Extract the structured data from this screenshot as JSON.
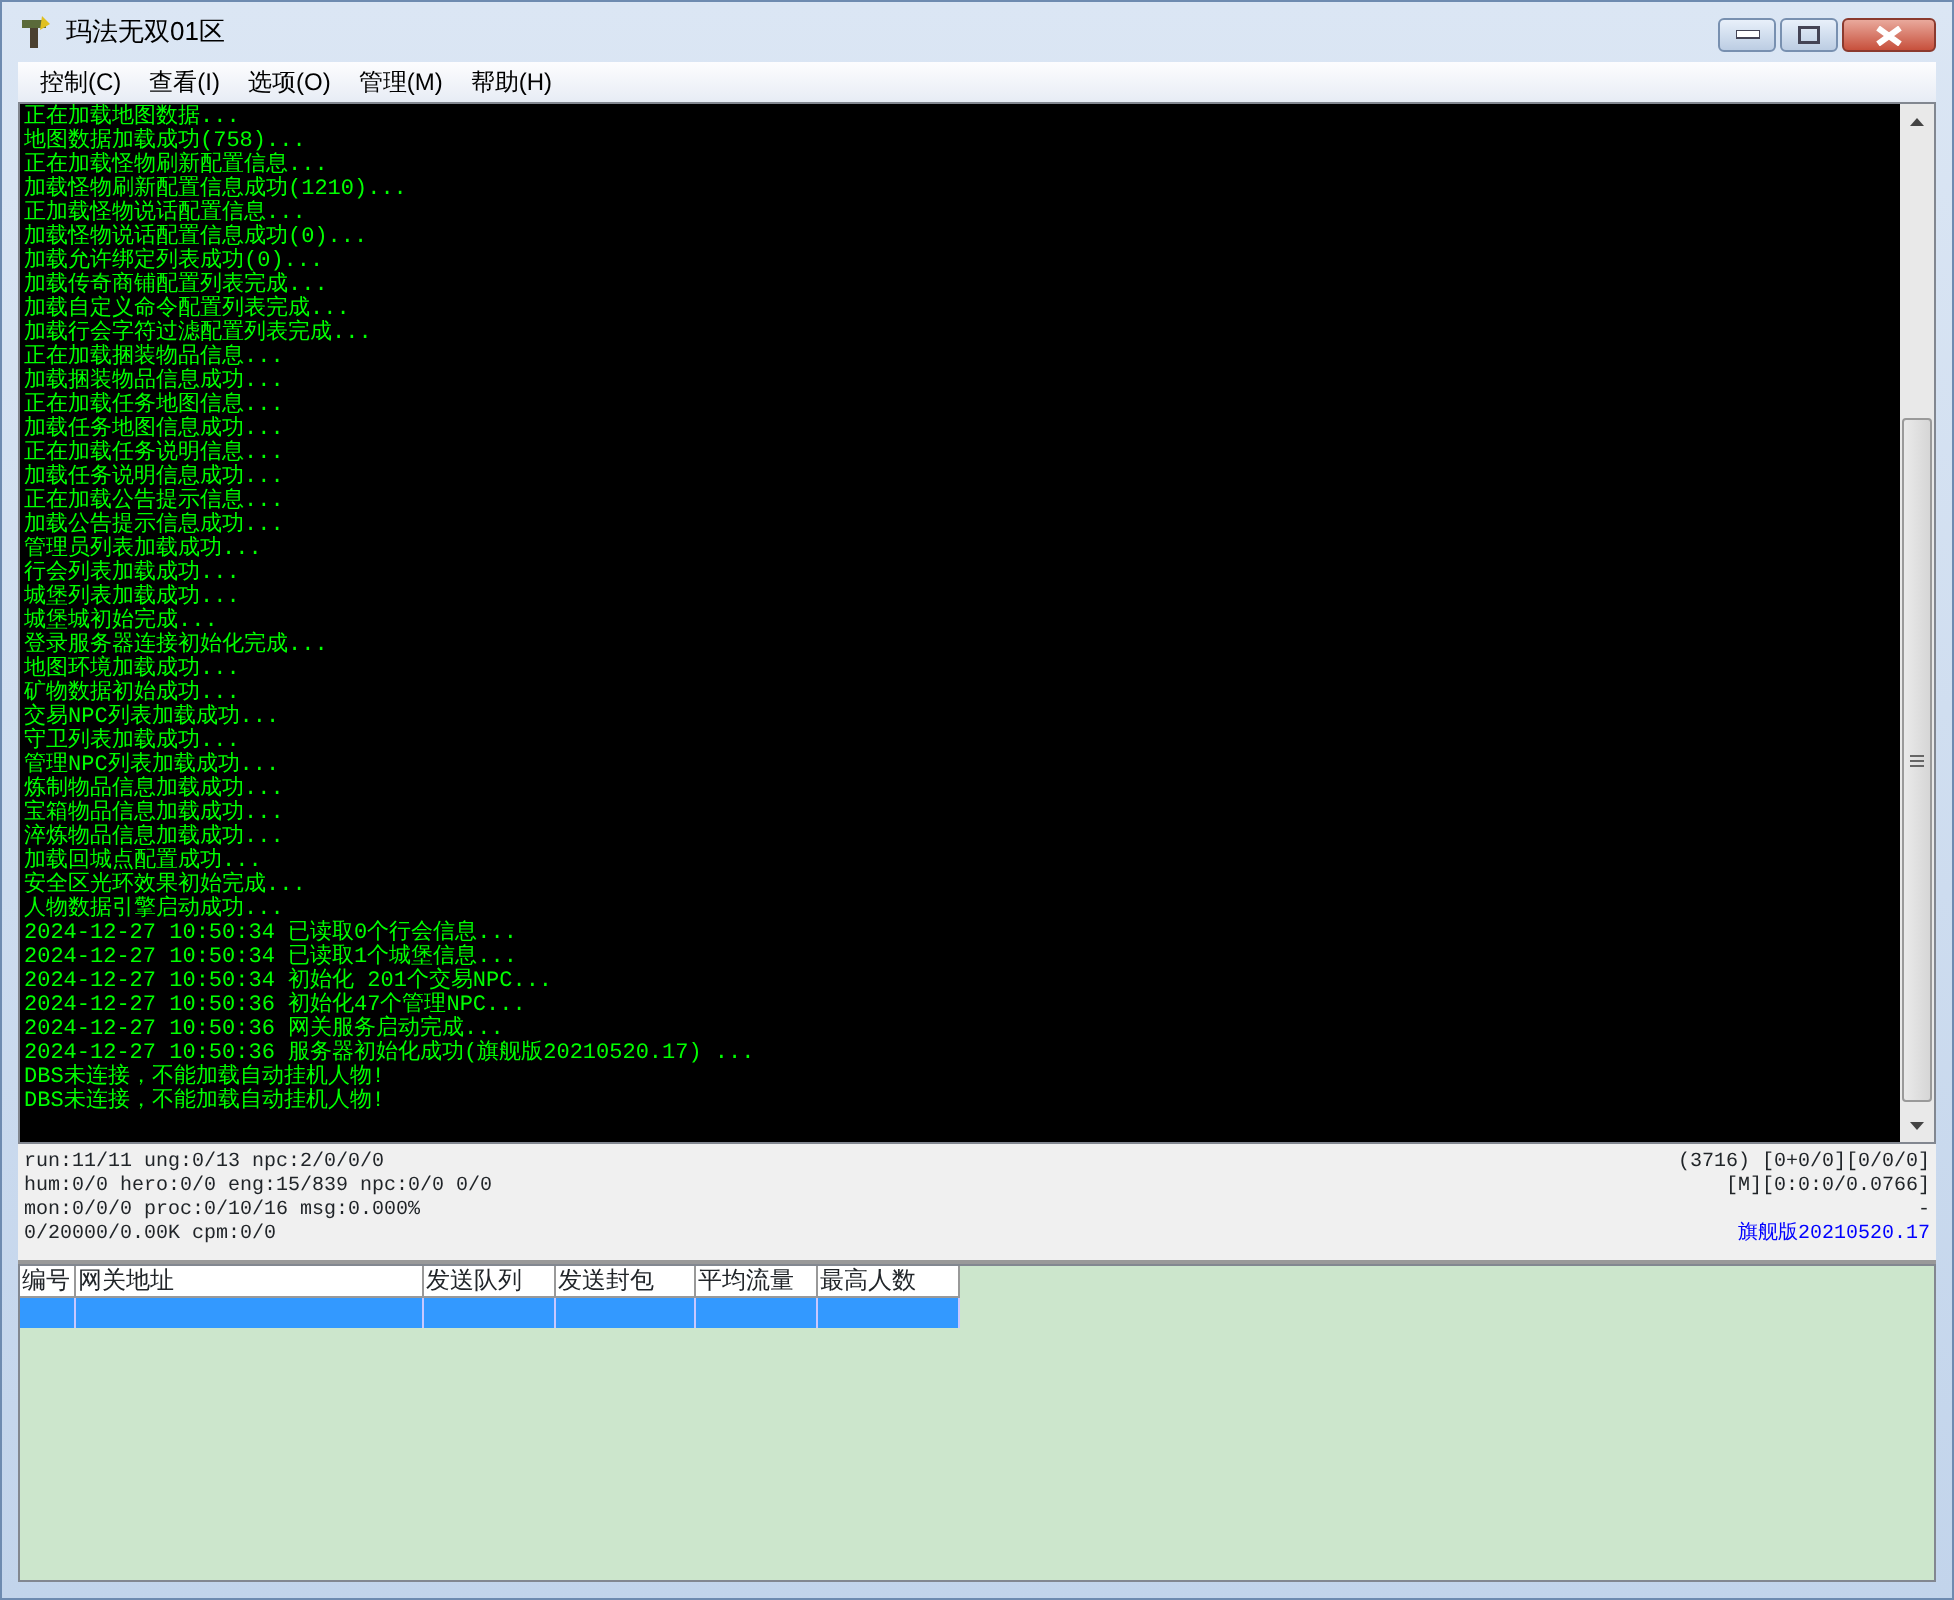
{
  "window": {
    "title": "玛法无双01区"
  },
  "menu": [
    "控制(C)",
    "查看(I)",
    "选项(O)",
    "管理(M)",
    "帮助(H)"
  ],
  "console": {
    "lines": [
      "正在加载地图数据...",
      "地图数据加载成功(758)...",
      "正在加载怪物刷新配置信息...",
      "加载怪物刷新配置信息成功(1210)...",
      "正加载怪物说话配置信息...",
      "加载怪物说话配置信息成功(0)...",
      "加载允许绑定列表成功(0)...",
      "加载传奇商铺配置列表完成...",
      "加载自定义命令配置列表完成...",
      "加载行会字符过滤配置列表完成...",
      "正在加载捆装物品信息...",
      "加载捆装物品信息成功...",
      "正在加载任务地图信息...",
      "加载任务地图信息成功...",
      "正在加载任务说明信息...",
      "加载任务说明信息成功...",
      "正在加载公告提示信息...",
      "加载公告提示信息成功...",
      "管理员列表加载成功...",
      "行会列表加载成功...",
      "城堡列表加载成功...",
      "城堡城初始完成...",
      "登录服务器连接初始化完成...",
      "地图环境加载成功...",
      "矿物数据初始成功...",
      "交易NPC列表加载成功...",
      "守卫列表加载成功...",
      "管理NPC列表加载成功...",
      "炼制物品信息加载成功...",
      "宝箱物品信息加载成功...",
      "淬炼物品信息加载成功...",
      "加载回城点配置成功...",
      "安全区光环效果初始完成...",
      "人物数据引擎启动成功...",
      "2024-12-27 10:50:34 已读取0个行会信息...",
      "2024-12-27 10:50:34 已读取1个城堡信息...",
      "2024-12-27 10:50:34 初始化 201个交易NPC...",
      "2024-12-27 10:50:36 初始化47个管理NPC...",
      "2024-12-27 10:50:36 网关服务启动完成...",
      "2024-12-27 10:50:36 服务器初始化成功(旗舰版20210520.17) ...",
      "DBS未连接，不能加载自动挂机人物!",
      "DBS未连接，不能加载自动挂机人物!"
    ]
  },
  "status": {
    "left": [
      "run:11/11 ung:0/13 npc:2/0/0/0",
      "hum:0/0 hero:0/0 eng:15/839 npc:0/0 0/0",
      "mon:0/0/0 proc:0/10/16 msg:0.000%",
      "0/20000/0.00K cpm:0/0"
    ],
    "right": [
      "(3716) [0+0/0][0/0/0]",
      "[M][0:0:0/0.0766]",
      "-"
    ],
    "version": "旗舰版20210520.17"
  },
  "table": {
    "columns": [
      "编号",
      "网关地址",
      "发送队列",
      "发送封包",
      "平均流量",
      "最高人数"
    ],
    "rows": [
      {
        "selected": true
      }
    ]
  }
}
